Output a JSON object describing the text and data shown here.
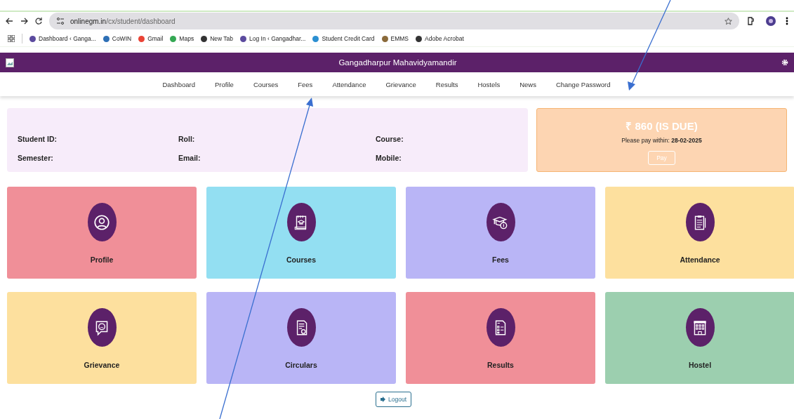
{
  "browser": {
    "url_host": "onlinegm.in",
    "url_path": "/cx/student/dashboard",
    "bookmarks": [
      {
        "label": "Dashboard ‹ Ganga..."
      },
      {
        "label": "CoWIN"
      },
      {
        "label": "Gmail"
      },
      {
        "label": "Maps"
      },
      {
        "label": "New Tab"
      },
      {
        "label": "Log In ‹ Gangadhar..."
      },
      {
        "label": "Student Credit Card"
      },
      {
        "label": "EMMS"
      },
      {
        "label": "Adobe Acrobat"
      }
    ]
  },
  "header": {
    "title": "Gangadharpur Mahavidyamandir"
  },
  "nav": [
    "Dashboard",
    "Profile",
    "Courses",
    "Fees",
    "Attendance",
    "Grievance",
    "Results",
    "Hostels",
    "News",
    "Change Password"
  ],
  "student_info": {
    "rows": [
      [
        "Student ID:",
        "Roll:",
        "Course:"
      ],
      [
        "Semester:",
        "Email:",
        "Mobile:"
      ]
    ]
  },
  "fee": {
    "amount": "₹ 860 (IS DUE)",
    "note_label": "Please pay within:",
    "due_date": "28-02-2025",
    "button": "Pay"
  },
  "tiles": [
    {
      "label": "Profile",
      "color": "#f08f98"
    },
    {
      "label": "Courses",
      "color": "#93dff2"
    },
    {
      "label": "Fees",
      "color": "#b9b5f6"
    },
    {
      "label": "Attendance",
      "color": "#fde09e"
    },
    {
      "label": "Grievance",
      "color": "#fde09e"
    },
    {
      "label": "Circulars",
      "color": "#b9b5f6"
    },
    {
      "label": "Results",
      "color": "#f08f98"
    },
    {
      "label": "Hostel",
      "color": "#9ccfaf"
    }
  ],
  "logout": "Logout"
}
